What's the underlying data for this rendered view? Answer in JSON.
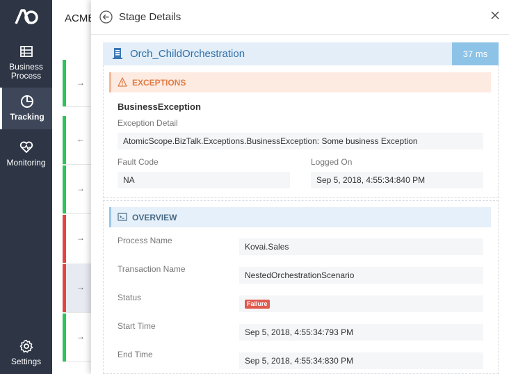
{
  "nav": {
    "items": [
      {
        "label": "Business Process",
        "icon": "business-process-icon"
      },
      {
        "label": "Tracking",
        "icon": "tracking-icon"
      },
      {
        "label": "Monitoring",
        "icon": "monitoring-icon"
      },
      {
        "label": "Settings",
        "icon": "gear-icon"
      }
    ]
  },
  "background": {
    "title": "ACME",
    "rows": [
      {
        "arrow": "→",
        "status": "success"
      },
      {
        "arrow": "←",
        "status": "success"
      },
      {
        "arrow": "→",
        "status": "success"
      },
      {
        "arrow": "→",
        "status": "failure"
      },
      {
        "arrow": "→",
        "status": "failure"
      },
      {
        "arrow": "→",
        "status": "success"
      }
    ]
  },
  "panel": {
    "title": "Stage Details",
    "stage": {
      "name": "Orch_ChildOrchestration",
      "duration": "37 ms"
    },
    "exceptions": {
      "heading": "EXCEPTIONS",
      "name": "BusinessException",
      "detail_label": "Exception Detail",
      "detail_value": "AtomicScope.BizTalk.Exceptions.BusinessException: Some business Exception",
      "fault_label": "Fault Code",
      "fault_value": "NA",
      "logged_label": "Logged On",
      "logged_value": "Sep 5, 2018, 4:55:34:840 PM"
    },
    "overview": {
      "heading": "OVERVIEW",
      "process_label": "Process Name",
      "process_value": "Kovai.Sales",
      "transaction_label": "Transaction Name",
      "transaction_value": "NestedOrchestrationScenario",
      "status_label": "Status",
      "status_value": "Failure",
      "start_label": "Start Time",
      "start_value": "Sep 5, 2018, 4:55:34:793 PM",
      "end_label": "End Time",
      "end_value": "Sep 5, 2018, 4:55:34:830 PM"
    }
  },
  "colors": {
    "nav": "#2e3645",
    "success": "#2ec45a",
    "failure": "#e0463f",
    "accent": "#2d6ea8",
    "duration": "#8ec3e8"
  }
}
